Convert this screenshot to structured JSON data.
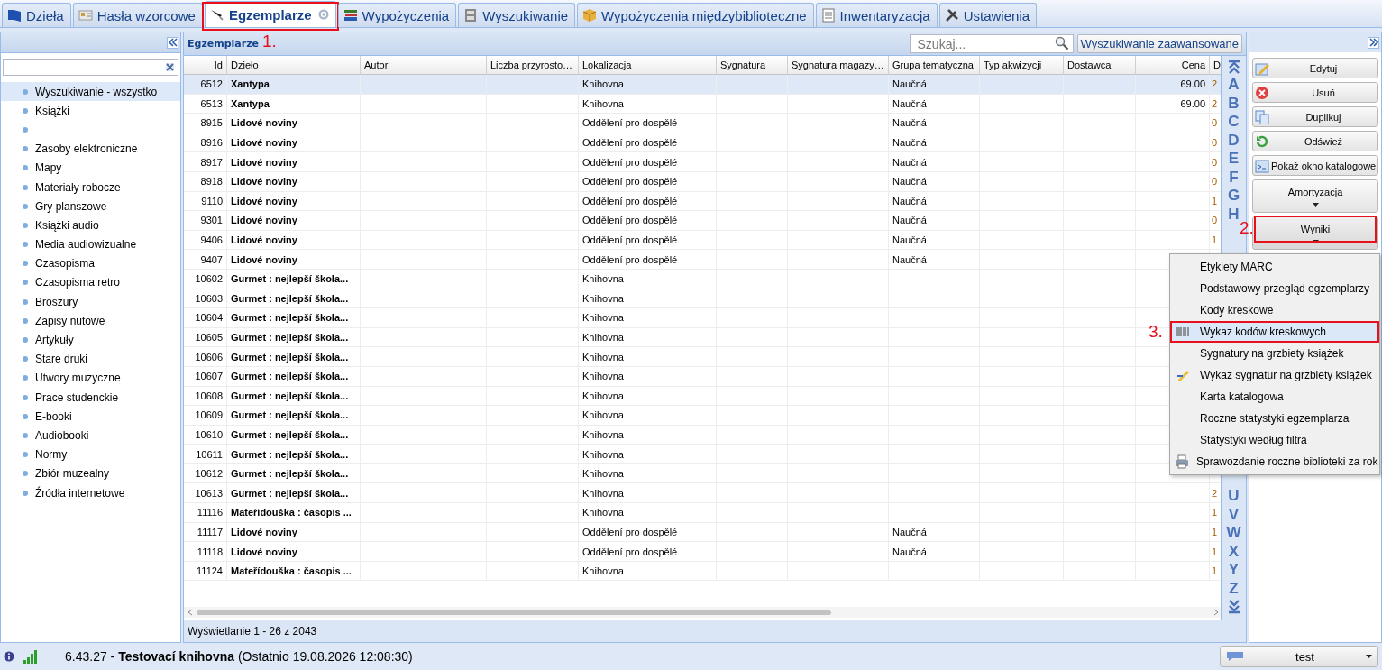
{
  "tabs": [
    {
      "label": "Dzieła",
      "selected": false
    },
    {
      "label": "Hasła wzorcowe",
      "selected": false
    },
    {
      "label": "Egzemplarze",
      "selected": true,
      "annotation": "1."
    },
    {
      "label": "Wypożyczenia",
      "selected": false
    },
    {
      "label": "Wyszukiwanie",
      "selected": false
    },
    {
      "label": "Wypożyczenia międzybiblioteczne",
      "selected": false
    },
    {
      "label": "Inwentaryzacja",
      "selected": false
    },
    {
      "label": "Ustawienia",
      "selected": false
    }
  ],
  "sidebar": {
    "items": [
      {
        "label": "Wyszukiwanie - wszystko",
        "selected": true
      },
      {
        "label": "Książki",
        "selected": false
      },
      {
        "selected": false
      },
      {
        "label": "Zasoby elektroniczne",
        "selected": false
      },
      {
        "label": "Mapy",
        "selected": false
      },
      {
        "label": "Materiały robocze",
        "selected": false
      },
      {
        "label": "Gry planszowe",
        "selected": false
      },
      {
        "label": "Książki audio",
        "selected": false
      },
      {
        "label": "Media audiowizualne",
        "selected": false
      },
      {
        "label": "Czasopisma",
        "selected": false
      },
      {
        "label": "Czasopisma retro",
        "selected": false
      },
      {
        "label": "Broszury",
        "selected": false
      },
      {
        "label": "Zapisy nutowe",
        "selected": false
      },
      {
        "label": "Artykuły",
        "selected": false
      },
      {
        "label": "Stare druki",
        "selected": false
      },
      {
        "label": "Utwory muzyczne",
        "selected": false
      },
      {
        "label": "Prace studenckie",
        "selected": false
      },
      {
        "label": "E-booki",
        "selected": false
      },
      {
        "label": "Audiobooki",
        "selected": false
      },
      {
        "label": "Normy",
        "selected": false
      },
      {
        "label": "Zbiór muzealny",
        "selected": false
      },
      {
        "label": "Źródła internetowe",
        "selected": false
      }
    ]
  },
  "grid": {
    "title": "Egzemplarze",
    "search": {
      "placeholder": "Szukaj..."
    },
    "advanced_button": "Wyszukiwanie zaawansowane",
    "columns": [
      "Id",
      "Dzieło",
      "Autor",
      "Liczba przyrosto…",
      "Lokalizacja",
      "Sygnatura",
      "Sygnatura magazy…",
      "Grupa tematyczna",
      "Typ akwizycji",
      "Dostawca",
      "Cena",
      "D"
    ],
    "rows": [
      {
        "selected": true,
        "cells": [
          "6512",
          "Xantypa",
          "",
          "",
          "Knihovna",
          "",
          "",
          "Naučná",
          "",
          "",
          "69.00",
          "2"
        ]
      },
      {
        "selected": false,
        "cells": [
          "6513",
          "Xantypa",
          "",
          "",
          "Knihovna",
          "",
          "",
          "Naučná",
          "",
          "",
          "69.00",
          "2"
        ]
      },
      {
        "selected": false,
        "cells": [
          "8915",
          "Lidové noviny",
          "",
          "",
          "Oddělení pro dospělé",
          "",
          "",
          "Naučná",
          "",
          "",
          "",
          "0"
        ]
      },
      {
        "selected": false,
        "cells": [
          "8916",
          "Lidové noviny",
          "",
          "",
          "Oddělení pro dospělé",
          "",
          "",
          "Naučná",
          "",
          "",
          "",
          "0"
        ]
      },
      {
        "selected": false,
        "cells": [
          "8917",
          "Lidové noviny",
          "",
          "",
          "Oddělení pro dospělé",
          "",
          "",
          "Naučná",
          "",
          "",
          "",
          "0"
        ]
      },
      {
        "selected": false,
        "cells": [
          "8918",
          "Lidové noviny",
          "",
          "",
          "Oddělení pro dospělé",
          "",
          "",
          "Naučná",
          "",
          "",
          "",
          "0"
        ]
      },
      {
        "selected": false,
        "cells": [
          "9110",
          "Lidové noviny",
          "",
          "",
          "Oddělení pro dospělé",
          "",
          "",
          "Naučná",
          "",
          "",
          "",
          "1"
        ]
      },
      {
        "selected": false,
        "cells": [
          "9301",
          "Lidové noviny",
          "",
          "",
          "Oddělení pro dospělé",
          "",
          "",
          "Naučná",
          "",
          "",
          "",
          "0"
        ]
      },
      {
        "selected": false,
        "cells": [
          "9406",
          "Lidové noviny",
          "",
          "",
          "Oddělení pro dospělé",
          "",
          "",
          "Naučná",
          "",
          "",
          "",
          "1"
        ]
      },
      {
        "selected": false,
        "cells": [
          "9407",
          "Lidové noviny",
          "",
          "",
          "Oddělení pro dospělé",
          "",
          "",
          "Naučná",
          "",
          "",
          "",
          ""
        ]
      },
      {
        "selected": false,
        "cells": [
          "10602",
          "Gurmet : nejlepší škola...",
          "",
          "",
          "Knihovna",
          "",
          "",
          "",
          "",
          "",
          "",
          ""
        ]
      },
      {
        "selected": false,
        "cells": [
          "10603",
          "Gurmet : nejlepší škola...",
          "",
          "",
          "Knihovna",
          "",
          "",
          "",
          "",
          "",
          "",
          ""
        ]
      },
      {
        "selected": false,
        "cells": [
          "10604",
          "Gurmet : nejlepší škola...",
          "",
          "",
          "Knihovna",
          "",
          "",
          "",
          "",
          "",
          "",
          ""
        ]
      },
      {
        "selected": false,
        "cells": [
          "10605",
          "Gurmet : nejlepší škola...",
          "",
          "",
          "Knihovna",
          "",
          "",
          "",
          "",
          "",
          "",
          ""
        ]
      },
      {
        "selected": false,
        "cells": [
          "10606",
          "Gurmet : nejlepší škola...",
          "",
          "",
          "Knihovna",
          "",
          "",
          "",
          "",
          "",
          "",
          ""
        ]
      },
      {
        "selected": false,
        "cells": [
          "10607",
          "Gurmet : nejlepší škola...",
          "",
          "",
          "Knihovna",
          "",
          "",
          "",
          "",
          "",
          "",
          ""
        ]
      },
      {
        "selected": false,
        "cells": [
          "10608",
          "Gurmet : nejlepší škola...",
          "",
          "",
          "Knihovna",
          "",
          "",
          "",
          "",
          "",
          "",
          ""
        ]
      },
      {
        "selected": false,
        "cells": [
          "10609",
          "Gurmet : nejlepší škola...",
          "",
          "",
          "Knihovna",
          "",
          "",
          "",
          "",
          "",
          "",
          ""
        ]
      },
      {
        "selected": false,
        "cells": [
          "10610",
          "Gurmet : nejlepší škola...",
          "",
          "",
          "Knihovna",
          "",
          "",
          "",
          "",
          "",
          "",
          ""
        ]
      },
      {
        "selected": false,
        "cells": [
          "10611",
          "Gurmet : nejlepší škola...",
          "",
          "",
          "Knihovna",
          "",
          "",
          "",
          "",
          "",
          "",
          ""
        ]
      },
      {
        "selected": false,
        "cells": [
          "10612",
          "Gurmet : nejlepší škola...",
          "",
          "",
          "Knihovna",
          "",
          "",
          "",
          "",
          "",
          "",
          ""
        ]
      },
      {
        "selected": false,
        "cells": [
          "10613",
          "Gurmet : nejlepší škola...",
          "",
          "",
          "Knihovna",
          "",
          "",
          "",
          "",
          "",
          "",
          "2"
        ]
      },
      {
        "selected": false,
        "cells": [
          "11116",
          "Mateřídouška : časopis ...",
          "",
          "",
          "Knihovna",
          "",
          "",
          "",
          "",
          "",
          "",
          "1"
        ]
      },
      {
        "selected": false,
        "cells": [
          "11117",
          "Lidové noviny",
          "",
          "",
          "Oddělení pro dospělé",
          "",
          "",
          "Naučná",
          "",
          "",
          "",
          "1"
        ]
      },
      {
        "selected": false,
        "cells": [
          "11118",
          "Lidové noviny",
          "",
          "",
          "Oddělení pro dospělé",
          "",
          "",
          "Naučná",
          "",
          "",
          "",
          "1"
        ]
      },
      {
        "selected": false,
        "cells": [
          "11124",
          "Mateřídouška : časopis ...",
          "",
          "",
          "Knihovna",
          "",
          "",
          "",
          "",
          "",
          "",
          "1"
        ]
      }
    ],
    "letters_top": [
      "A",
      "B",
      "C",
      "D",
      "E",
      "F",
      "G",
      "H"
    ],
    "letters_bottom": [
      "U",
      "V",
      "W",
      "X",
      "Y",
      "Z"
    ],
    "footer": "Wyświetlanie 1 - 26 z 2043"
  },
  "actions": [
    {
      "label": "Edytuj",
      "kind": "icon"
    },
    {
      "label": "Usuń",
      "kind": "icon"
    },
    {
      "label": "Duplikuj",
      "kind": "icon"
    },
    {
      "label": "Odśwież",
      "kind": "icon"
    },
    {
      "label": "Pokaż okno katalogowe",
      "kind": "icon"
    },
    {
      "label": "Amortyzacja",
      "kind": "dropdown",
      "expanded": false
    },
    {
      "label": "Wyniki",
      "kind": "dropdown",
      "expanded": true,
      "annotation": "2."
    }
  ],
  "menu": [
    {
      "label": "Etykiety MARC",
      "kind": "plain",
      "selected": false
    },
    {
      "label": "Podstawowy przegląd egzemplarzy",
      "kind": "plain",
      "selected": false
    },
    {
      "label": "Kody kreskowe",
      "kind": "plain",
      "selected": false
    },
    {
      "label": "Wykaz kodów kreskowych",
      "kind": "barcode",
      "selected": true,
      "annotation": "3."
    },
    {
      "label": "Sygnatury na grzbiety książek",
      "kind": "plain",
      "selected": false
    },
    {
      "label": "Wykaz sygnatur na grzbiety książek",
      "kind": "pencil",
      "selected": false
    },
    {
      "label": "Karta katalogowa",
      "kind": "plain",
      "selected": false
    },
    {
      "label": "Roczne statystyki egzemplarza",
      "kind": "plain",
      "selected": false
    },
    {
      "label": "Statystyki według filtra",
      "kind": "plain",
      "selected": false
    },
    {
      "label": "Sprawozdanie roczne biblioteki za rok",
      "kind": "printer",
      "selected": false
    }
  ],
  "status_bar": {
    "text": "6.43.27 - **Testovací knihovna** (Ostatnio 19.08.2026 12:08:30)",
    "user": "test"
  }
}
